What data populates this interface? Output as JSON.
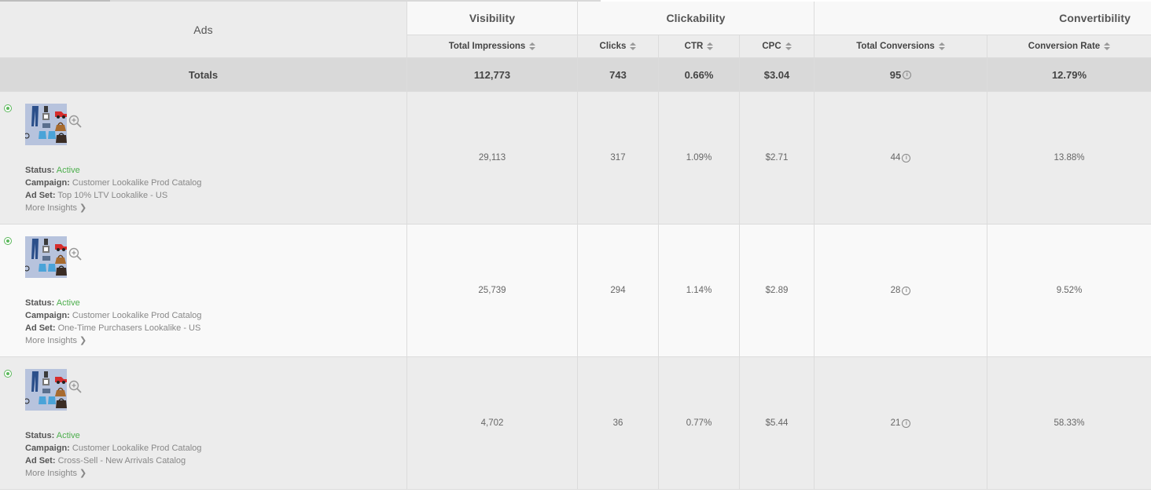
{
  "header": {
    "ads_label": "Ads",
    "groups": {
      "visibility": "Visibility",
      "clickability": "Clickability",
      "convertibility": "Convertibility"
    },
    "columns": {
      "total_impressions": "Total Impressions",
      "clicks": "Clicks",
      "ctr": "CTR",
      "cpc": "CPC",
      "total_conversions": "Total Conversions",
      "conversion_rate": "Conversion Rate"
    }
  },
  "totals": {
    "label": "Totals",
    "total_impressions": "112,773",
    "clicks": "743",
    "ctr": "0.66%",
    "cpc": "$3.04",
    "total_conversions": "95",
    "conversion_rate": "12.79%"
  },
  "labels": {
    "status": "Status:",
    "campaign": "Campaign:",
    "ad_set": "Ad Set:",
    "more_insights": "More Insights"
  },
  "rows": [
    {
      "status": "Active",
      "campaign": "Customer Lookalike Prod Catalog",
      "ad_set": "Top 10% LTV Lookalike - US",
      "total_impressions": "29,113",
      "clicks": "317",
      "ctr": "1.09%",
      "cpc": "$2.71",
      "total_conversions": "44",
      "conversion_rate": "13.88%"
    },
    {
      "status": "Active",
      "campaign": "Customer Lookalike Prod Catalog",
      "ad_set": "One-Time Purchasers Lookalike - US",
      "total_impressions": "25,739",
      "clicks": "294",
      "ctr": "1.14%",
      "cpc": "$2.89",
      "total_conversions": "28",
      "conversion_rate": "9.52%"
    },
    {
      "status": "Active",
      "campaign": "Customer Lookalike Prod Catalog",
      "ad_set": "Cross-Sell - New Arrivals Catalog",
      "total_impressions": "4,702",
      "clicks": "36",
      "ctr": "0.77%",
      "cpc": "$5.44",
      "total_conversions": "21",
      "conversion_rate": "58.33%"
    }
  ],
  "colors": {
    "active": "#4cae4c",
    "header_bg": "#ececec",
    "totals_bg": "#d9d9d9",
    "row_alt": "#ececec",
    "row": "#f9f9f9"
  },
  "icons": {
    "selected": "radio-selected-icon",
    "zoom": "zoom-in-icon",
    "info": "info-icon",
    "sort": "sort-icon",
    "more": "chevron-right-icon"
  }
}
